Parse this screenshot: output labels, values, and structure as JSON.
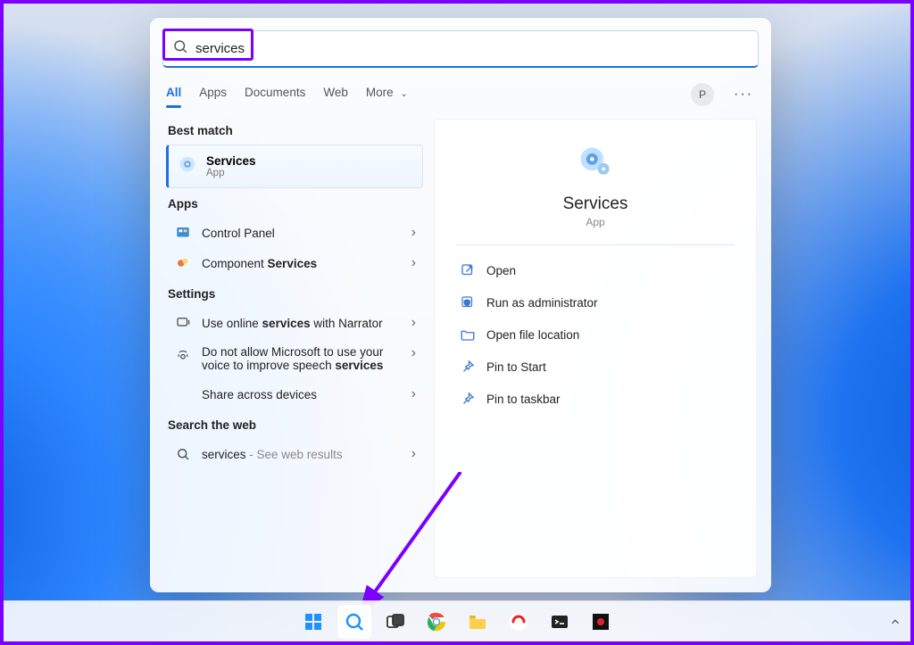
{
  "colors": {
    "accent": "#1f6fe0",
    "annotation": "#7a00ff"
  },
  "search": {
    "query": "services"
  },
  "tabs": {
    "items": [
      "All",
      "Apps",
      "Documents",
      "Web",
      "More"
    ],
    "activeIndex": 0
  },
  "user": {
    "initial": "P"
  },
  "sections": {
    "bestMatch": "Best match",
    "apps": "Apps",
    "settings": "Settings",
    "web": "Search the web"
  },
  "bestMatch": {
    "title": "Services",
    "subtitle": "App"
  },
  "apps": [
    {
      "label": "Control Panel"
    },
    {
      "label_pre": "Component ",
      "label_bold": "Services"
    }
  ],
  "settings": [
    {
      "label_pre": "Use online ",
      "label_bold": "services",
      "label_post": " with Narrator",
      "icon": "narrator"
    },
    {
      "label_pre": "Do not allow Microsoft to use your voice to improve speech ",
      "label_bold": "services",
      "icon": "voice"
    },
    {
      "label": "Share across devices",
      "icon": "none"
    }
  ],
  "web": {
    "query": "services",
    "suffix": "See web results"
  },
  "preview": {
    "title": "Services",
    "subtitle": "App",
    "actions": [
      {
        "icon": "open",
        "label": "Open"
      },
      {
        "icon": "admin",
        "label": "Run as administrator"
      },
      {
        "icon": "folder",
        "label": "Open file location"
      },
      {
        "icon": "pin",
        "label": "Pin to Start"
      },
      {
        "icon": "pin",
        "label": "Pin to taskbar"
      }
    ]
  },
  "taskbar": {
    "items": [
      {
        "name": "start"
      },
      {
        "name": "search",
        "active": true
      },
      {
        "name": "taskview"
      },
      {
        "name": "chrome"
      },
      {
        "name": "explorer"
      },
      {
        "name": "app-circle"
      },
      {
        "name": "terminal"
      },
      {
        "name": "app-dark"
      }
    ]
  }
}
